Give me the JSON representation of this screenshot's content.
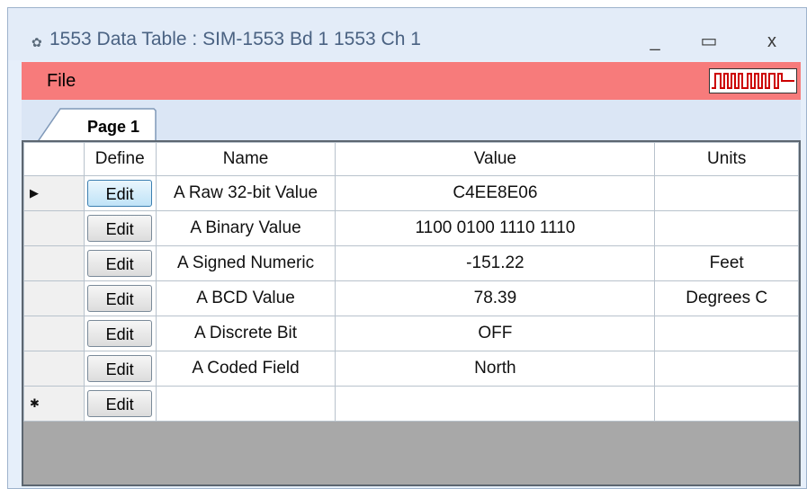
{
  "window": {
    "title": "1553 Data Table : SIM-1553 Bd 1 1553 Ch 1",
    "minimize_glyph": "_",
    "maximize_glyph": "▭",
    "close_glyph": "x"
  },
  "menu": {
    "file_label": "File"
  },
  "tabs": [
    {
      "label": "Page 1"
    }
  ],
  "grid": {
    "columns": [
      "Define",
      "Name",
      "Value",
      "Units"
    ],
    "edit_label": "Edit",
    "rows": [
      {
        "indicator": "▶",
        "name": "A Raw 32-bit Value",
        "value": "C4EE8E06",
        "units": ""
      },
      {
        "indicator": "",
        "name": "A Binary Value",
        "value": "1100 0100 1110 1110",
        "units": ""
      },
      {
        "indicator": "",
        "name": "A Signed Numeric",
        "value": "-151.22",
        "units": "Feet"
      },
      {
        "indicator": "",
        "name": "A BCD Value",
        "value": "78.39",
        "units": "Degrees C"
      },
      {
        "indicator": "",
        "name": "A Discrete Bit",
        "value": "OFF",
        "units": ""
      },
      {
        "indicator": "",
        "name": "A Coded Field",
        "value": "North",
        "units": ""
      }
    ],
    "new_row_indicator": "✱"
  },
  "colors": {
    "menubar": "#f77b7b",
    "signal": "#cc0000"
  }
}
